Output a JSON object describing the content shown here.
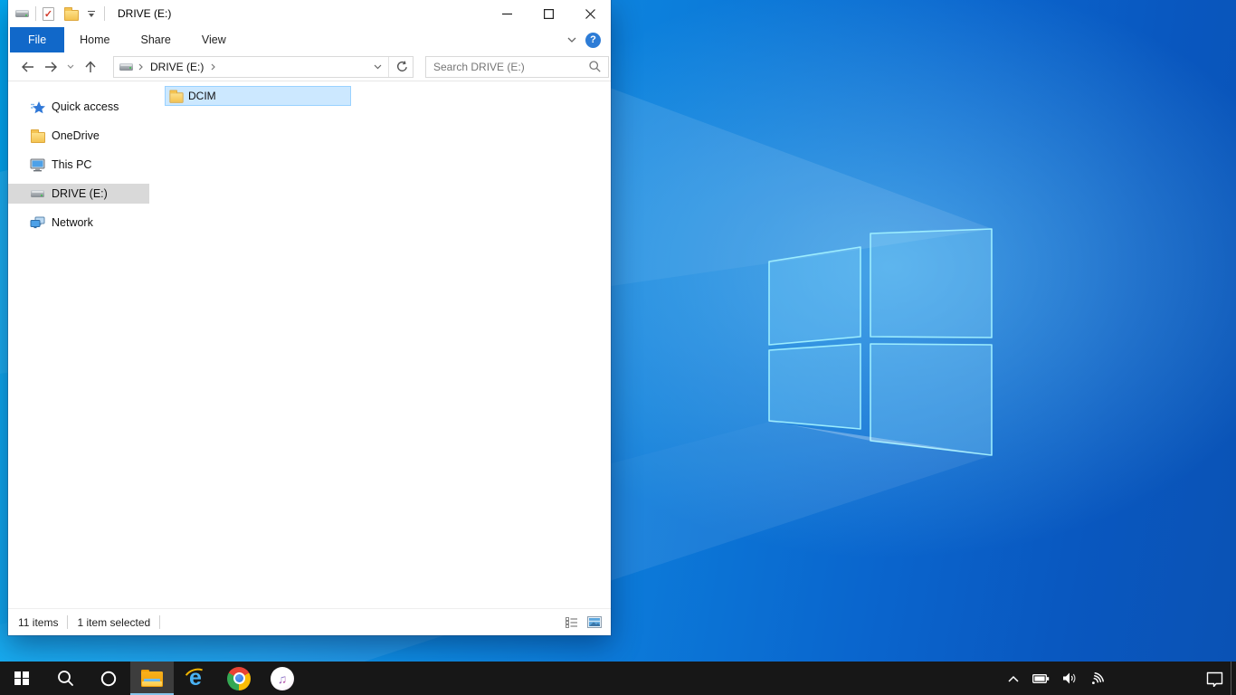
{
  "explorer": {
    "titlebar": {
      "title": "DRIVE (E:)",
      "qat_icons": [
        "drive-icon",
        "properties-icon",
        "new-folder-icon",
        "customize-qat-dropdown"
      ]
    },
    "ribbon_tabs": {
      "file": "File",
      "home": "Home",
      "share": "Share",
      "view": "View",
      "help_glyph": "?"
    },
    "address_bar": {
      "crumb_root_icon": "drive-icon",
      "crumb1": "DRIVE (E:)"
    },
    "search": {
      "placeholder": "Search DRIVE (E:)"
    },
    "sidebar": {
      "items": [
        {
          "label": "Quick access",
          "icon": "quick-access-star",
          "selected": false
        },
        {
          "label": "OneDrive",
          "icon": "onedrive-folder",
          "selected": false
        },
        {
          "label": "This PC",
          "icon": "this-pc-monitor",
          "selected": false
        },
        {
          "label": "DRIVE (E:)",
          "icon": "drive",
          "selected": true
        },
        {
          "label": "Network",
          "icon": "network-computers",
          "selected": false
        }
      ]
    },
    "files": [
      {
        "name": "DCIM",
        "icon": "folder",
        "selected": true
      }
    ],
    "status": {
      "count": "11 items",
      "selected": "1 item selected",
      "view_icons": [
        "details-view",
        "large-thumbnail-view"
      ]
    }
  },
  "taskbar": {
    "buttons": [
      {
        "name": "start",
        "icon": "windows-logo"
      },
      {
        "name": "search",
        "icon": "magnifier"
      },
      {
        "name": "cortana",
        "icon": "circle-ring"
      },
      {
        "name": "file-explorer",
        "icon": "folder",
        "active": true
      },
      {
        "name": "internet-explorer",
        "icon": "ie-e"
      },
      {
        "name": "chrome",
        "icon": "chrome-circle"
      },
      {
        "name": "itunes",
        "icon": "music-note",
        "glyph": "♫"
      }
    ],
    "tray_icons": [
      "chevron-up",
      "battery",
      "volume",
      "wifi",
      "action-center"
    ]
  },
  "colors": {
    "ribbon_file_tab": "#1168c9",
    "selection_fill": "#cce8ff",
    "selection_border": "#99d1ff",
    "sidebar_selected": "#d9d9d9",
    "taskbar": "#171717",
    "wallpaper_left": "#00a9f0",
    "wallpaper_right": "#0a52b4"
  }
}
